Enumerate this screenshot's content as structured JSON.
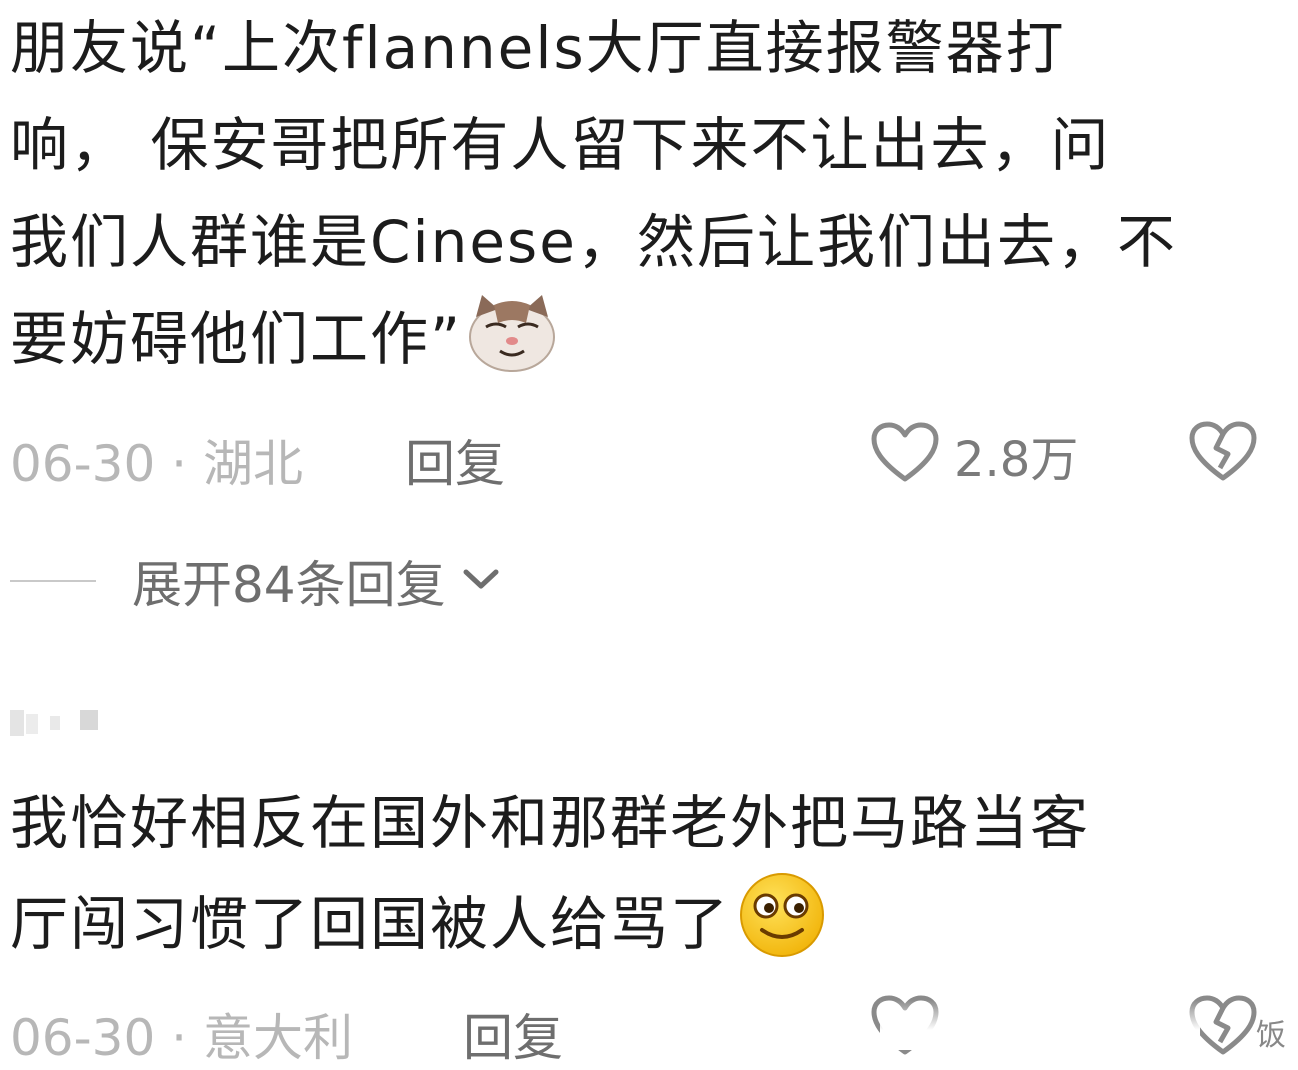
{
  "comments": [
    {
      "lines": [
        "朋友说“上次flannels大厅直接报警器打",
        "响， 保安哥把所有人留下来不让出去，问",
        "我们人群谁是Cinese，然后让我们出去，不",
        "要妨碍他们工作”"
      ],
      "emoji": "smug-cat-emoji",
      "date": "06-30",
      "location": "湖北",
      "meta": "06-30 · 湖北",
      "reply_label": "回复",
      "like_count": "2.8万",
      "expand_label": "展开84条回复"
    },
    {
      "username": "",
      "lines": [
        "我恰好相反在国外和那群老外把马路当客",
        "厅闯习惯了回国被人给骂了"
      ],
      "emoji": "smile-emoji",
      "date": "06-30",
      "location": "意大利",
      "meta": "06-30 · 意大利",
      "reply_label": "回复",
      "like_count": "",
      "watermark": "饭"
    }
  ],
  "colors": {
    "text": "#1c1c1c",
    "meta": "#b7b7b7",
    "action": "#6e6e6e",
    "icon": "#8a8a8a"
  }
}
